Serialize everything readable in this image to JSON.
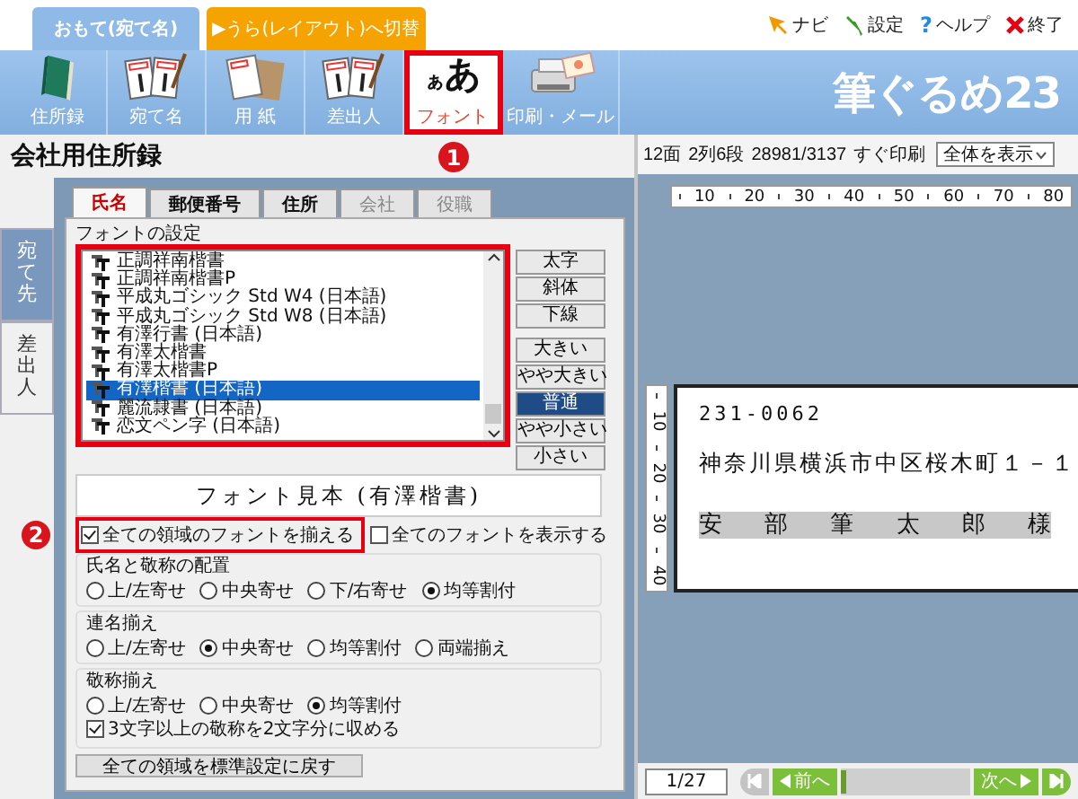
{
  "mode_tabs": [
    {
      "label": "おもて(宛て名)",
      "selected": true
    },
    {
      "label": "▶うら(レイアウト)へ切替",
      "selected": false
    }
  ],
  "top_links": [
    {
      "kind": "navi",
      "label": "ナビ"
    },
    {
      "kind": "settings",
      "label": "設定"
    },
    {
      "kind": "help",
      "symbol": "?",
      "label": "ヘルプ"
    },
    {
      "kind": "exit",
      "label": "終了"
    }
  ],
  "toolbar": {
    "buttons": [
      {
        "kind": "book",
        "label": "住所録",
        "selected": false,
        "highlighted": false
      },
      {
        "kind": "cards",
        "label": "宛て名",
        "selected": false,
        "highlighted": false
      },
      {
        "kind": "paper",
        "label": "用 紙",
        "selected": false,
        "highlighted": false
      },
      {
        "kind": "cards",
        "label": "差出人",
        "selected": false,
        "highlighted": false
      },
      {
        "kind": "font",
        "symbol": "ぁあ",
        "label": "フォント",
        "selected": true,
        "highlighted": true,
        "callout": "1"
      },
      {
        "kind": "printer",
        "label": "印刷・メール",
        "selected": false,
        "highlighted": false
      }
    ],
    "logo": "筆ぐるめ23"
  },
  "address_book": {
    "title": "会社用住所録",
    "side_tabs": [
      {
        "label": "宛て先",
        "selected": true
      },
      {
        "label": "差出人",
        "selected": false
      }
    ],
    "field_tabs": [
      {
        "label": "氏名",
        "selected": true,
        "disabled": false
      },
      {
        "label": "郵便番号",
        "selected": false,
        "disabled": false
      },
      {
        "label": "住所",
        "selected": false,
        "disabled": false
      },
      {
        "label": "会社",
        "selected": false,
        "disabled": true
      },
      {
        "label": "役職",
        "selected": false,
        "disabled": true
      }
    ],
    "font_settings": {
      "label": "フォントの設定",
      "highlighted": true,
      "fonts": [
        {
          "name": "正調祥南楷書",
          "selected": false
        },
        {
          "name": "正調祥南楷書P",
          "selected": false
        },
        {
          "name": "平成丸ゴシック Std W4 (日本語)",
          "selected": false
        },
        {
          "name": "平成丸ゴシック Std W8 (日本語)",
          "selected": false
        },
        {
          "name": "有澤行書 (日本語)",
          "selected": false
        },
        {
          "name": "有澤太楷書",
          "selected": false
        },
        {
          "name": "有澤太楷書P",
          "selected": false
        },
        {
          "name": "有澤楷書 (日本語)",
          "selected": true
        },
        {
          "name": "麗流隷書 (日本語)",
          "selected": false
        },
        {
          "name": "恋文ペン字 (日本語)",
          "selected": false
        }
      ],
      "style_buttons": [
        {
          "label": "太字"
        },
        {
          "label": "斜体"
        },
        {
          "label": "下線"
        }
      ],
      "size_buttons": [
        {
          "label": "大きい",
          "selected": false
        },
        {
          "label": "やや大きい",
          "selected": false
        },
        {
          "label": "普通",
          "selected": true
        },
        {
          "label": "やや小さい",
          "selected": false
        },
        {
          "label": "小さい",
          "selected": false
        }
      ],
      "sample": "フォント見本 (有澤楷書)"
    },
    "options": [
      {
        "label": "全ての領域のフォントを揃える",
        "checked": true,
        "highlighted": true,
        "callout": "2"
      },
      {
        "label": "全てのフォントを表示する",
        "checked": false,
        "highlighted": false
      }
    ],
    "groups": [
      {
        "title": "氏名と敬称の配置",
        "radios": [
          {
            "label": "上/左寄せ",
            "selected": false
          },
          {
            "label": "中央寄せ",
            "selected": false
          },
          {
            "label": "下/右寄せ",
            "selected": false
          },
          {
            "label": "均等割付",
            "selected": true
          }
        ]
      },
      {
        "title": "連名揃え",
        "radios": [
          {
            "label": "上/左寄せ",
            "selected": false
          },
          {
            "label": "中央寄せ",
            "selected": true
          },
          {
            "label": "均等割付",
            "selected": false
          },
          {
            "label": "両端揃え",
            "selected": false
          }
        ]
      },
      {
        "title": "敬称揃え",
        "radios": [
          {
            "label": "上/左寄せ",
            "selected": false
          },
          {
            "label": "中央寄せ",
            "selected": false
          },
          {
            "label": "均等割付",
            "selected": true
          }
        ],
        "checkboxes": [
          {
            "label": "3文字以上の敬称を2文字分に収める",
            "checked": true
          }
        ]
      }
    ],
    "reset_button": "全ての領域を標準設定に戻す"
  },
  "preview": {
    "info": [
      "12面",
      "2列6段",
      "28981/3137",
      "すぐ印刷"
    ],
    "view_select": "全体を表示",
    "ruler_h": [
      "10",
      "20",
      "30",
      "40",
      "50",
      "60",
      "70",
      "80"
    ],
    "ruler_v": [
      "10",
      "20",
      "30",
      "40"
    ],
    "card": {
      "postal_code": "231-0062",
      "address": "神奈川県横浜市中区桜木町１－１",
      "name": "安 部 筆 太 郎 様"
    },
    "pager": {
      "page": "1/27",
      "level": 0.03,
      "buttons": [
        {
          "kind": "first",
          "disabled": true
        },
        {
          "kind": "prev",
          "label": "前へ",
          "disabled": false
        },
        {
          "kind": "next",
          "label": "次へ",
          "disabled": false
        },
        {
          "kind": "last",
          "disabled": false
        }
      ]
    }
  }
}
